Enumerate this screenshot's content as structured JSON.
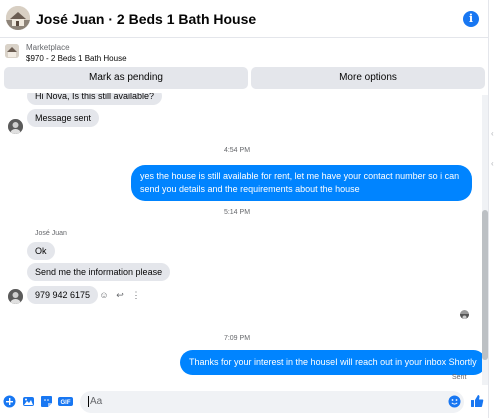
{
  "header": {
    "title": "José Juan · 2 Beds 1 Bath House",
    "info_icon": "info-circle-icon",
    "accent_color": "#1877f2"
  },
  "marketplace": {
    "label": "Marketplace",
    "item": "$970 - 2 Beds 1 Bath House",
    "pending_button": "Mark as pending",
    "more_button": "More options"
  },
  "messages": {
    "incoming_1": "Hi Nova, Is this still available?",
    "incoming_2": "Message sent",
    "time_1": "4:54 PM",
    "outgoing_1": "yes the house is still available for rent, let me have your contact number so i can send you details and the requirements about the house",
    "time_2": "5:14 PM",
    "sender_name": "José Juan",
    "incoming_3": "Ok",
    "incoming_4": "Send me the information please",
    "incoming_5": "979 942 6175",
    "time_3": "7:09 PM",
    "outgoing_2": "Thanks for your interest in the houseI will reach out in your inbox Shortly",
    "sent_status": "Sent"
  },
  "composer": {
    "placeholder": "Aa",
    "icons": [
      "plus-circle-icon",
      "photo-icon",
      "sticker-icon",
      "gif-icon",
      "emoji-icon",
      "thumbs-up-icon"
    ]
  },
  "colors": {
    "outgoing_bubble": "#0084ff",
    "incoming_bubble": "#e4e6eb",
    "button_bg": "#e4e6eb"
  }
}
